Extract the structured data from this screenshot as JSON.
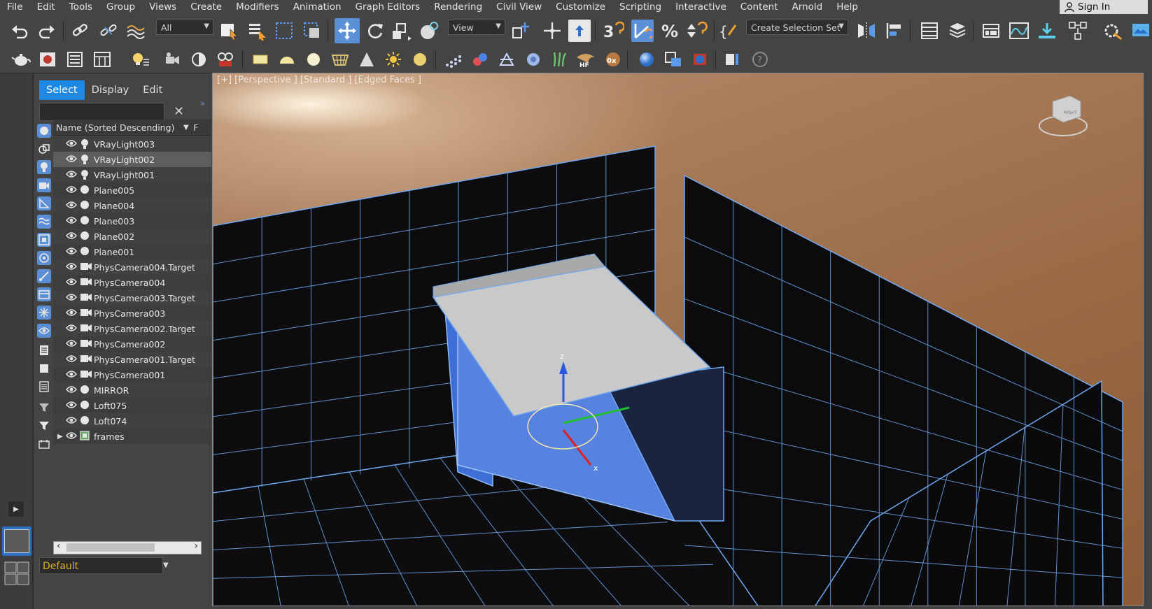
{
  "menu": [
    "File",
    "Edit",
    "Tools",
    "Group",
    "Views",
    "Create",
    "Modifiers",
    "Animation",
    "Graph Editors",
    "Rendering",
    "Civil View",
    "Customize",
    "Scripting",
    "Interactive",
    "Content",
    "Arnold",
    "Help"
  ],
  "signin": "Sign In",
  "toolbar": {
    "selection_filter": "All",
    "coord_system": "View",
    "selection_set": "Create Selection Set"
  },
  "explorer": {
    "tabs": [
      "Select",
      "Display",
      "Edit"
    ],
    "active_tab": "Select",
    "search_placeholder": "",
    "column_header": "Name (Sorted Descending)",
    "column_f": "F",
    "layer": "Default",
    "items": [
      {
        "name": "VRayLight003",
        "type": "light",
        "selected": false
      },
      {
        "name": "VRayLight002",
        "type": "light",
        "selected": true
      },
      {
        "name": "VRayLight001",
        "type": "light",
        "selected": false
      },
      {
        "name": "Plane005",
        "type": "geometry",
        "selected": false
      },
      {
        "name": "Plane004",
        "type": "geometry",
        "selected": false
      },
      {
        "name": "Plane003",
        "type": "geometry",
        "selected": false
      },
      {
        "name": "Plane002",
        "type": "geometry",
        "selected": false
      },
      {
        "name": "Plane001",
        "type": "geometry",
        "selected": false
      },
      {
        "name": "PhysCamera004.Target",
        "type": "camera",
        "selected": false
      },
      {
        "name": "PhysCamera004",
        "type": "camera",
        "selected": false
      },
      {
        "name": "PhysCamera003.Target",
        "type": "camera",
        "selected": false
      },
      {
        "name": "PhysCamera003",
        "type": "camera",
        "selected": false
      },
      {
        "name": "PhysCamera002.Target",
        "type": "camera",
        "selected": false
      },
      {
        "name": "PhysCamera002",
        "type": "camera",
        "selected": false
      },
      {
        "name": "PhysCamera001.Target",
        "type": "camera",
        "selected": false
      },
      {
        "name": "PhysCamera001",
        "type": "camera",
        "selected": false
      },
      {
        "name": "MIRROR",
        "type": "geometry",
        "selected": false
      },
      {
        "name": "Loft075",
        "type": "geometry",
        "selected": false
      },
      {
        "name": "Loft074",
        "type": "geometry",
        "selected": false
      },
      {
        "name": "frames",
        "type": "group",
        "selected": false
      }
    ]
  },
  "viewport": {
    "label": "[+] [Perspective ] [Standard ] [Edged Faces ]",
    "gizmo_axis_z": "z",
    "gizmo_axis_x": "x",
    "viewcube_face": "RIGHT"
  },
  "colors": {
    "accent": "#1e88e5",
    "toolbar_active": "#5b8fd6",
    "wire": "#6fa8f0",
    "layer_text": "#e0b020"
  }
}
